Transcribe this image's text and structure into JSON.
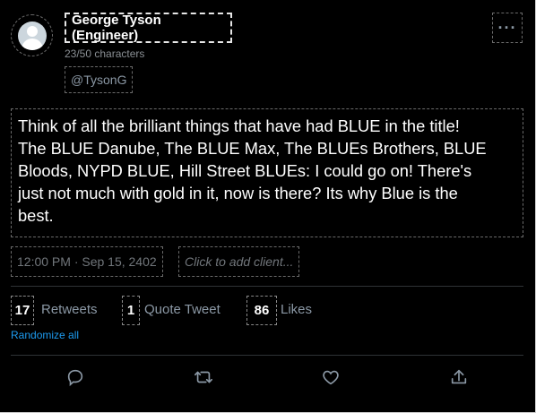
{
  "profile": {
    "display_name": "George Tyson (Engineer)",
    "char_count": "23/50 characters",
    "handle": "@TysonG"
  },
  "header": {
    "more_label": "···"
  },
  "tweet": {
    "lines": [
      "Think of all the brilliant things that have had BLUE in the title!",
      "The BLUE Danube, The BLUE Max, The BLUEs Brothers, BLUE",
      "Bloods, NYPD BLUE, Hill Street BLUEs: I could go on!  There's",
      "just not much with gold in it, now is there?  Its why Blue is the",
      "best."
    ]
  },
  "meta": {
    "timestamp": "12:00 PM · Sep 15, 2402",
    "client_placeholder": "Click to add client..."
  },
  "stats": {
    "retweets": {
      "count": "17",
      "label": "Retweets"
    },
    "quotes": {
      "count": "1",
      "label": "Quote Tweet"
    },
    "likes": {
      "count": "86",
      "label": "Likes"
    },
    "randomize_label": "Randomize all"
  },
  "actions": [
    "reply-icon",
    "retweet-icon",
    "like-icon",
    "share-icon"
  ],
  "colors": {
    "background": "#000000",
    "accent": "#1d9bf0",
    "muted": "#8b98a5"
  }
}
